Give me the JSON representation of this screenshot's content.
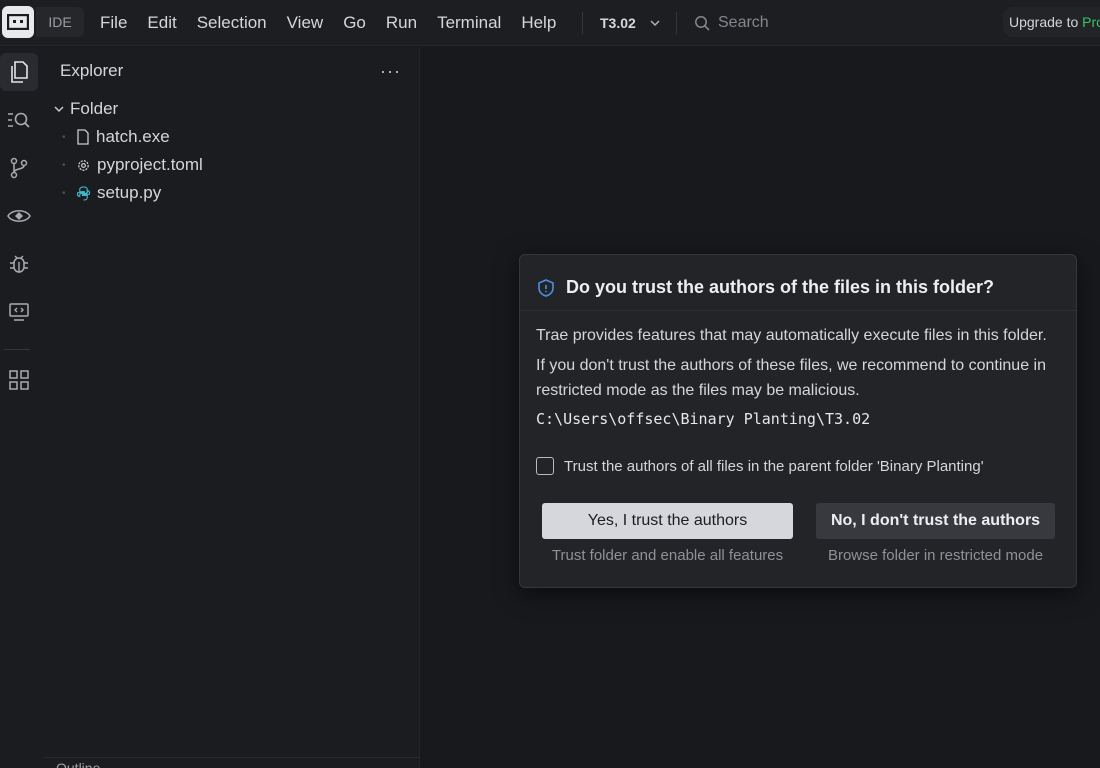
{
  "titlebar": {
    "ide_label": "IDE",
    "menu": [
      "File",
      "Edit",
      "Selection",
      "View",
      "Go",
      "Run",
      "Terminal",
      "Help"
    ],
    "project_name": "T3.02",
    "search_placeholder": "Search",
    "upgrade_text": "Upgrade to ",
    "upgrade_pro": "Pro"
  },
  "activity_bar": {
    "icons": [
      "explorer-icon",
      "search-icon",
      "source-control-icon",
      "preview-icon",
      "debug-icon",
      "remote-icon",
      "extensions-icon"
    ]
  },
  "sidebar": {
    "title": "Explorer",
    "more": "···",
    "folder_name": "Folder",
    "files": [
      {
        "name": "hatch.exe",
        "icon": "file-icon"
      },
      {
        "name": "pyproject.toml",
        "icon": "gear-icon"
      },
      {
        "name": "setup.py",
        "icon": "python-icon"
      }
    ],
    "outline_label": "Outline"
  },
  "dialog": {
    "title": "Do you trust the authors of the files in this folder?",
    "line1": "Trae provides features that may automatically execute files in this folder.",
    "line2": "If you don't trust the authors of these files, we recommend to continue in restricted mode as the files may be malicious.",
    "path": "C:\\Users\\offsec\\Binary Planting\\T3.02",
    "checkbox_label": "Trust the authors of all files in the parent folder 'Binary Planting'",
    "yes_label": "Yes, I trust the authors",
    "yes_sub": "Trust folder and enable all features",
    "no_label": "No, I don't trust the authors",
    "no_sub": "Browse folder in restricted mode"
  },
  "colors": {
    "accent_pro": "#37c36b",
    "shield": "#4a90e2",
    "python": "#3fb6c9"
  }
}
